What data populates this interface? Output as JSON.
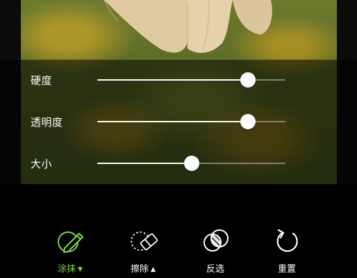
{
  "sliders": [
    {
      "label": "硬度",
      "value": 0.8
    },
    {
      "label": "透明度",
      "value": 0.8
    },
    {
      "label": "大小",
      "value": 0.5
    }
  ],
  "tools": [
    {
      "label": "涂抹",
      "caret": "▼",
      "active": true,
      "icon": "brush-smear-icon"
    },
    {
      "label": "擦除",
      "caret": "▲",
      "active": false,
      "icon": "eraser-icon"
    },
    {
      "label": "反选",
      "caret": "",
      "active": false,
      "icon": "invert-selection-icon"
    },
    {
      "label": "重置",
      "caret": "",
      "active": false,
      "icon": "reset-icon"
    }
  ],
  "colors": {
    "accent": "#7ddc49",
    "background": "#000000"
  }
}
